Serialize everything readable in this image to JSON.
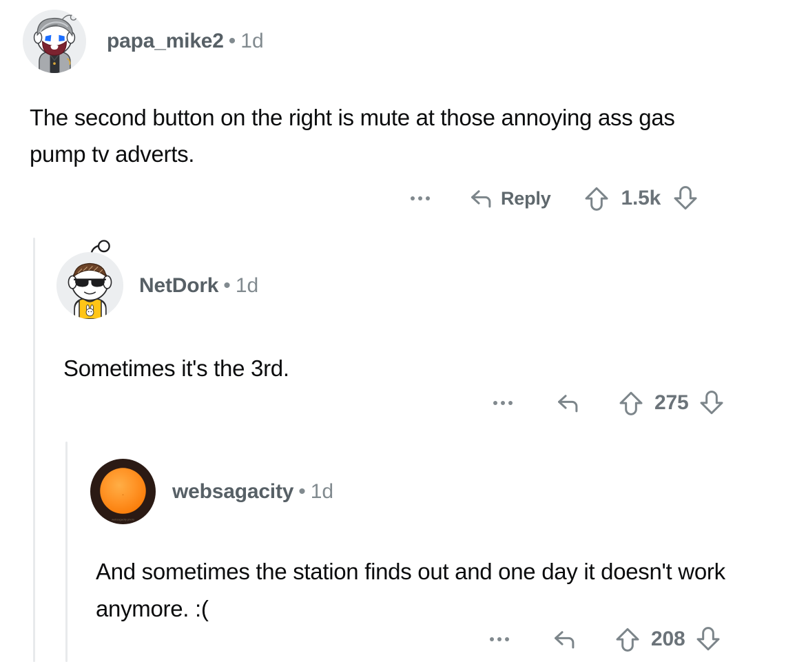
{
  "theme": {
    "background": "#ffffff",
    "body_text_color": "#0b0c0d",
    "username_color": "#576066",
    "meta_color": "#818a8f",
    "action_icon_color": "#7c858a",
    "thread_rail_color": "#e8eaec"
  },
  "comments": [
    {
      "id": "comment-1",
      "username": "papa_mike2",
      "separator": "•",
      "timestamp": "1d",
      "body": "The second button on the right is mute at those annoying ass gas pump tv adverts.",
      "avatar": {
        "name": "snoo-avatar-papa-mike2",
        "description": "snoo avatar with gray swept hair, blue eyes, dark red beard and gray jacket",
        "hair_color": "#9ea1a4",
        "eye_color": "#1a6dff",
        "beard_color": "#7c2330",
        "jacket_color": "#a7aaae",
        "background": "#eceef0"
      },
      "actions": {
        "overflow_label": "more options",
        "reply_label": "Reply",
        "show_reply_label": true,
        "upvote_label": "upvote",
        "downvote_label": "downvote",
        "vote_count": "1.5k"
      }
    },
    {
      "id": "comment-2",
      "username": "NetDork",
      "separator": "•",
      "timestamp": "1d",
      "body": "Sometimes it's the 3rd.",
      "avatar": {
        "name": "snoo-avatar-netdork",
        "description": "snoo avatar with brown hair, black sunglasses and a yellow bunny t-shirt",
        "hair_color": "#6b4227",
        "glasses_color": "#1d1d1f",
        "shirt_color": "#ffc517",
        "background": "#eceef0"
      },
      "actions": {
        "overflow_label": "more options",
        "reply_label": "Reply",
        "show_reply_label": false,
        "upvote_label": "upvote",
        "downvote_label": "downvote",
        "vote_count": "275"
      }
    },
    {
      "id": "comment-3",
      "username": "websagacity",
      "separator": "•",
      "timestamp": "1d",
      "body": "And sometimes the station finds out and one day it doesn't work anymore.  :(",
      "avatar": {
        "name": "sun-photo-avatar-websagacity",
        "description": "orange sun disc photo with dark brown ring border and small watermark",
        "disc_color": "#ff8c1a",
        "disc_highlight": "#ffab3d",
        "ring_color": "#2b1a14",
        "background": "#2b1a14"
      },
      "actions": {
        "overflow_label": "more options",
        "reply_label": "Reply",
        "show_reply_label": false,
        "upvote_label": "upvote",
        "downvote_label": "downvote",
        "vote_count": "208"
      }
    }
  ]
}
